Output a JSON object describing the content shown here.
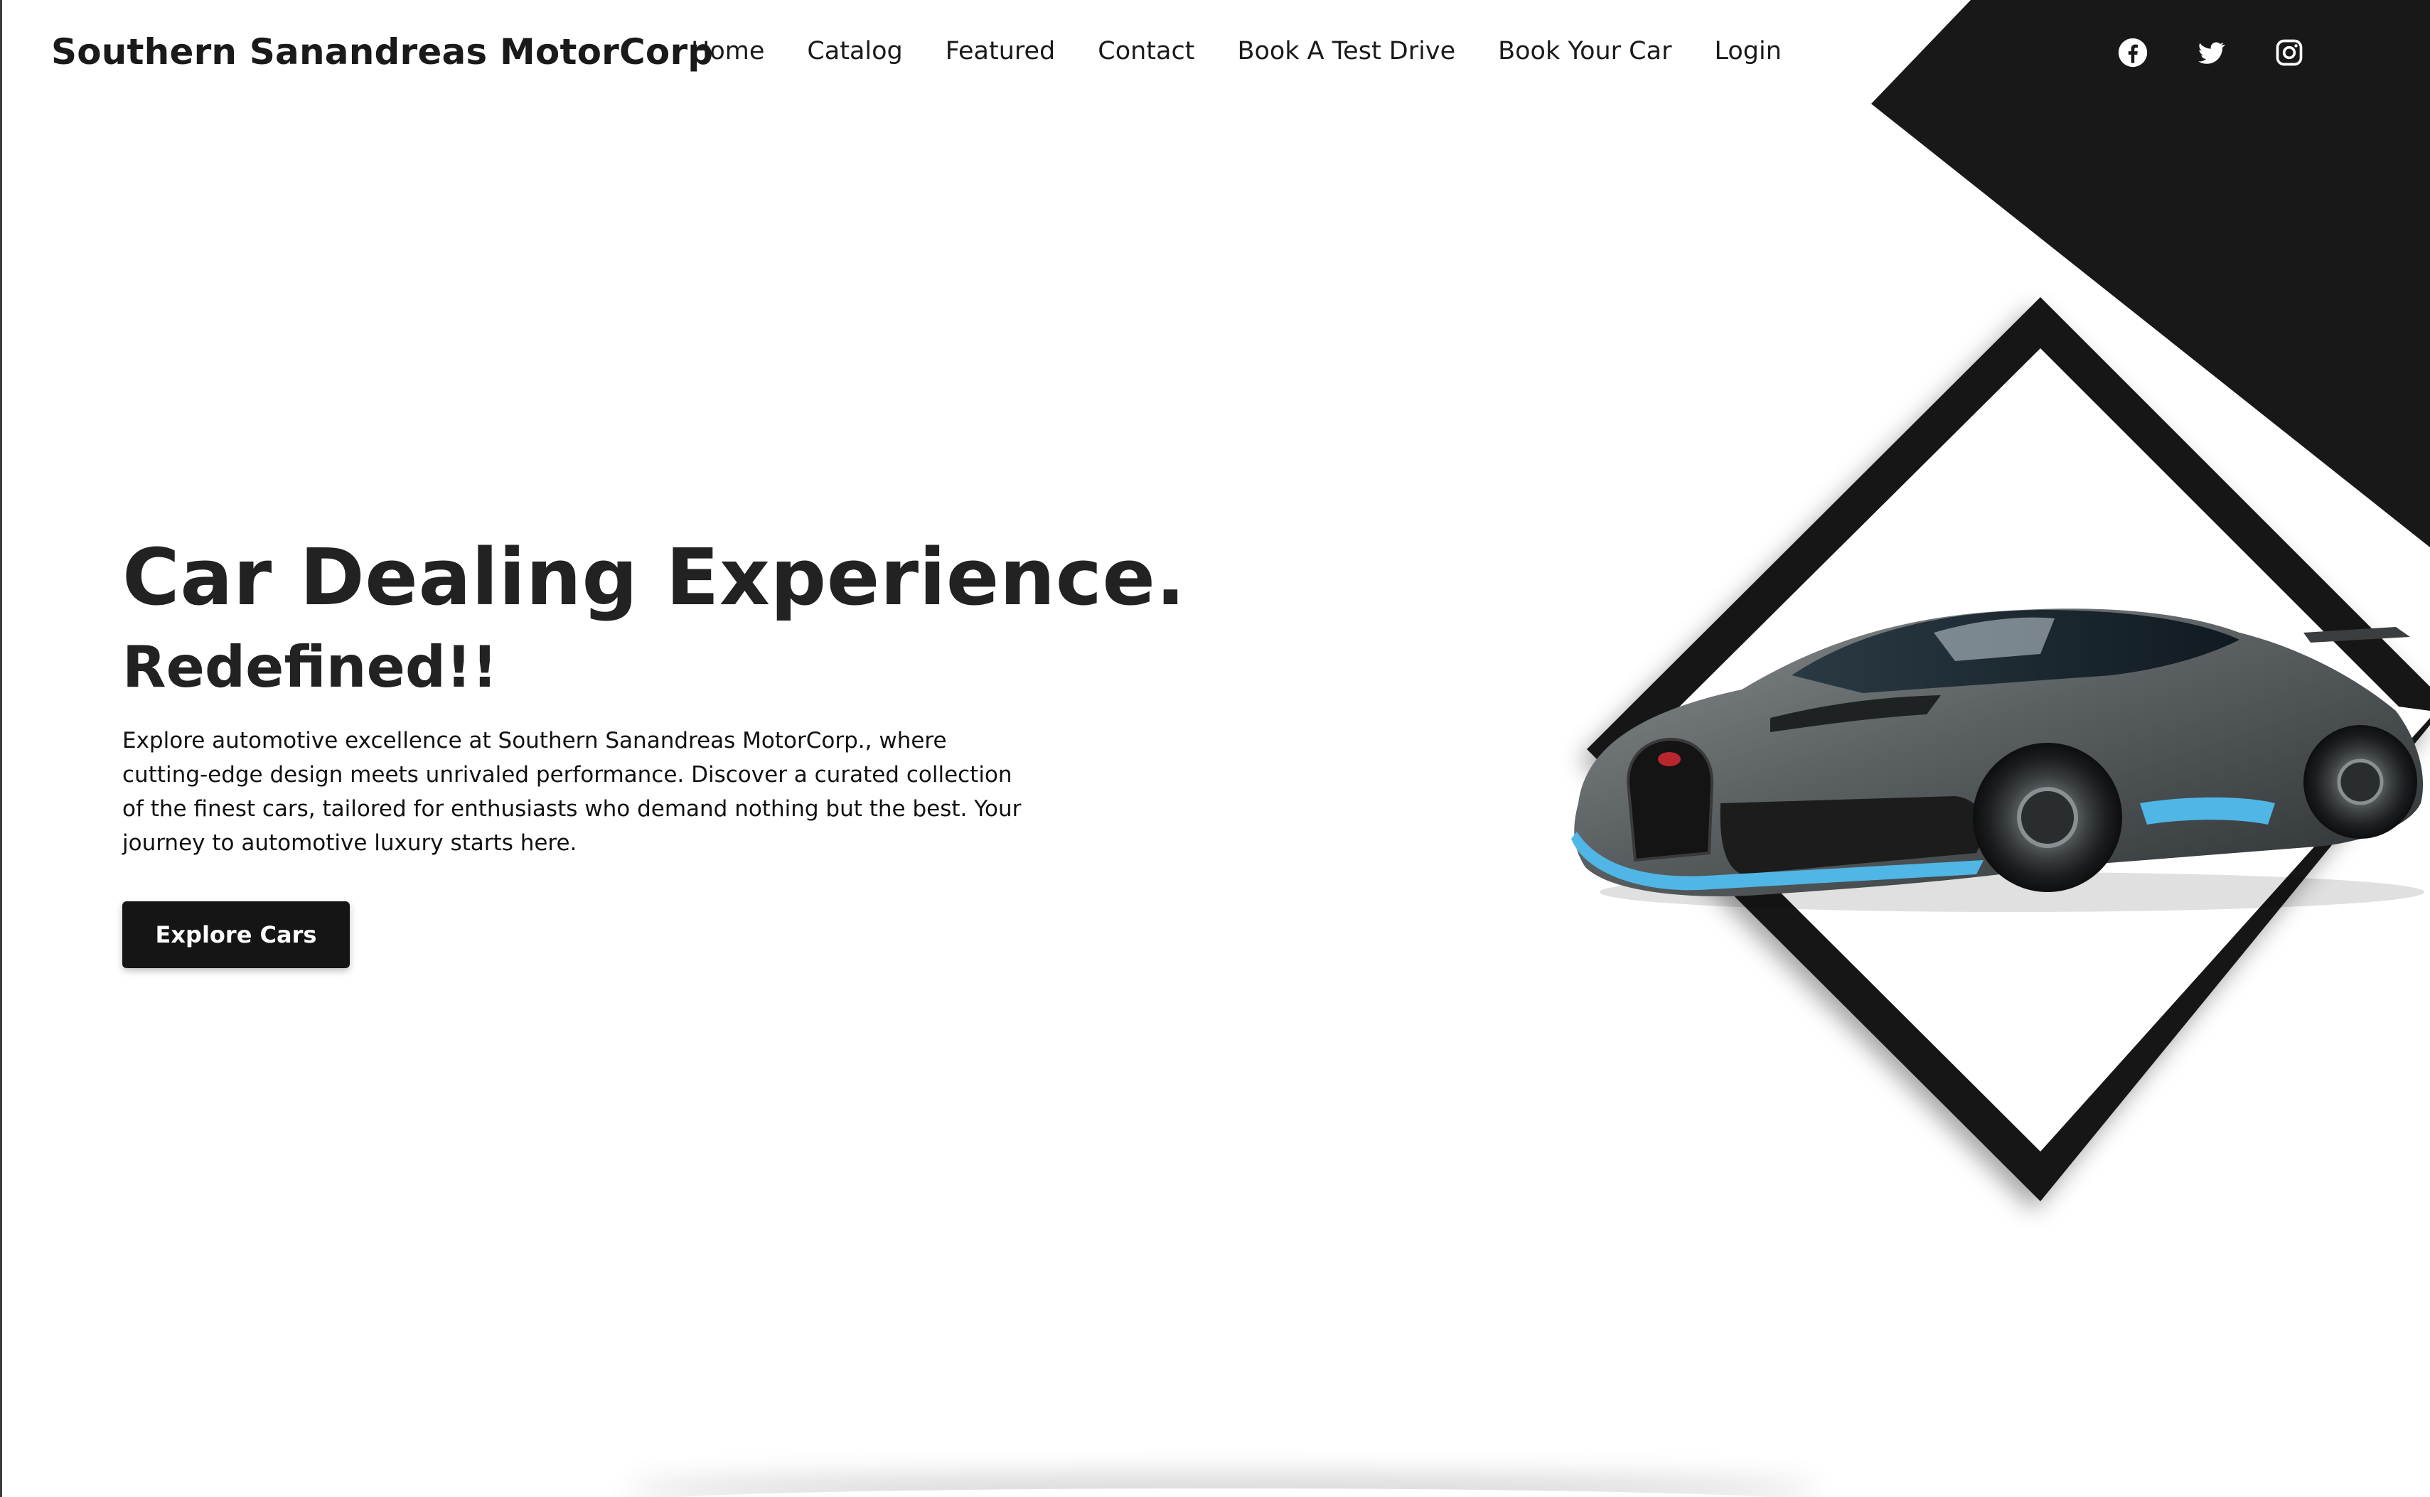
{
  "brand": {
    "name": "Southern Sanandreas MotorCorp"
  },
  "nav": {
    "items": [
      {
        "label": "Home"
      },
      {
        "label": "Catalog"
      },
      {
        "label": "Featured"
      },
      {
        "label": "Contact"
      },
      {
        "label": "Book A Test Drive"
      },
      {
        "label": "Book Your Car"
      },
      {
        "label": "Login"
      }
    ]
  },
  "social": {
    "icons": [
      "facebook-icon",
      "twitter-icon",
      "instagram-icon"
    ]
  },
  "hero": {
    "title": "Car Dealing Experience.",
    "subtitle": "Redefined!!",
    "description": "Explore automotive excellence at Southern Sanandreas MotorCorp., where cutting-edge design meets unrivaled performance. Discover a curated collection of the finest cars, tailored for enthusiasts who demand nothing but the best. Your journey to automotive luxury starts here.",
    "cta_label": "Explore Cars"
  },
  "colors": {
    "dark": "#1a1a1a",
    "accent_blue": "#4fb6e6",
    "background": "#ffffff"
  }
}
